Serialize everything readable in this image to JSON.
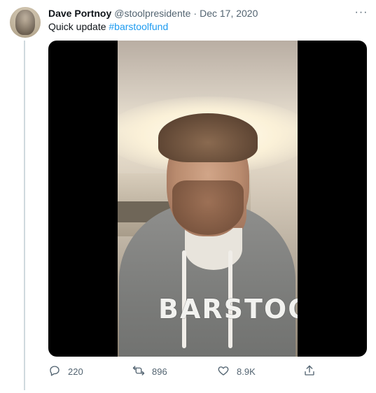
{
  "tweet": {
    "author_name": "Dave Portnoy",
    "handle": "@stoolpresidente",
    "separator": "·",
    "date": "Dec 17, 2020",
    "more_label": "···",
    "text_prefix": "Quick update ",
    "hashtag": "#barstoolfund",
    "media": {
      "hoodie_text": "BARSTOOL"
    },
    "actions": {
      "reply_count": "220",
      "retweet_count": "896",
      "like_count": "8.9K"
    },
    "icons": {
      "reply": "reply-icon",
      "retweet": "retweet-icon",
      "like": "heart-icon",
      "share": "share-icon",
      "more": "more-icon"
    },
    "colors": {
      "link": "#1d9bf0",
      "secondary_text": "#536471",
      "thread_line": "#cfd9de"
    }
  }
}
